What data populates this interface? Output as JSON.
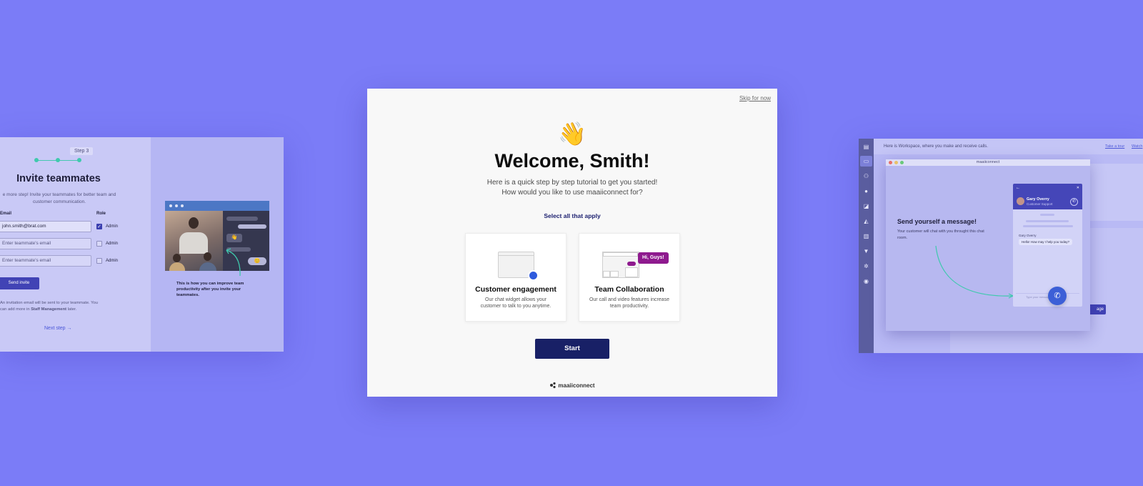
{
  "left_card": {
    "step_label": "Step 3",
    "title": "Invite teammates",
    "description": "e more step! Invite your teammates for better team and customer communication.",
    "email_header": "Email",
    "role_header": "Role",
    "rows": [
      {
        "email": "john.smith@brat.com",
        "placeholder": "",
        "role": "Admin",
        "checked": true
      },
      {
        "email": "",
        "placeholder": "Enter teammate's email",
        "role": "Admin",
        "checked": false
      },
      {
        "email": "",
        "placeholder": "Enter teammate's email",
        "role": "Admin",
        "checked": false
      }
    ],
    "send_button": "Send invite",
    "note_line1": "An invitation email will be sent to your teammate. You",
    "note_line2_prefix": "can add more in ",
    "note_link": "Staff Management",
    "note_line2_suffix": " later.",
    "next_step": "Next step →",
    "illustration_caption": "This is how you can improve team productivity after you invite your teammates."
  },
  "modal": {
    "skip": "Skip for now",
    "wave_emoji": "👋",
    "title": "Welcome, Smith!",
    "subtitle_line1": "Here is a quick step by step tutorial to get you started!",
    "subtitle_line2": "How would you like to use maaiiconnect for?",
    "select_prompt": "Select all that apply",
    "options": [
      {
        "title": "Customer engagement",
        "description": "Our chat widget allows your customer to talk to you anytime."
      },
      {
        "title": "Team Collaboration",
        "description": "Our call and video features increase team productivity.",
        "bubble": "Hi, Guys!"
      }
    ],
    "start_button": "Start",
    "brand": "maaiiconnect"
  },
  "right_card": {
    "topbar_text": "Here is Workspace, where you make and receive calls.",
    "link_tour": "Take a tour",
    "link_watch": "Watch",
    "window_title": "maaiiconnect",
    "send_title": "Send yourself a message!",
    "send_desc": "Your customer will chat with you throught this chat room.",
    "widget_name": "Gary Overry",
    "widget_role": "Customer Support",
    "widget_msg_author": "Gary Overry",
    "widget_bubble": "Hello! How may I help you today?",
    "widget_input_placeholder": "Type your message here",
    "bg_button": "age"
  },
  "colors": {
    "background": "#7b7cf7",
    "primary_button": "#182066",
    "accent_blue": "#2f5bdd",
    "accent_purple": "#8e1a8e",
    "stepper_teal": "#3fc9ad"
  }
}
